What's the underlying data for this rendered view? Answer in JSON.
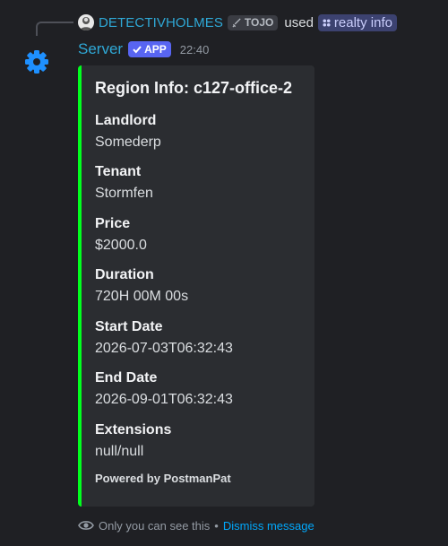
{
  "reply": {
    "username": "DETECTIVHOLMES",
    "tag": "TOJO",
    "used_text": "used",
    "command": "realty info"
  },
  "message": {
    "author": "Server",
    "badge": "APP",
    "timestamp": "22:40"
  },
  "embed": {
    "accent_color": "#00ff1e",
    "title": "Region Info: c127-office-2",
    "fields": [
      {
        "name": "Landlord",
        "value": "Somederp"
      },
      {
        "name": "Tenant",
        "value": "Stormfen"
      },
      {
        "name": "Price",
        "value": "$2000.0"
      },
      {
        "name": "Duration",
        "value": "720H 00M 00s"
      },
      {
        "name": "Start Date",
        "value": "2026-07-03T06:32:43"
      },
      {
        "name": "End Date",
        "value": "2026-09-01T06:32:43"
      },
      {
        "name": "Extensions",
        "value": "null/null"
      }
    ],
    "footer": "Powered by PostmanPat"
  },
  "ephemeral": {
    "text": "Only you can see this",
    "separator": "•",
    "dismiss": "Dismiss message"
  },
  "icons": {
    "avatar": "gear-icon",
    "visibility": "eye-icon",
    "command": "app-grid-icon",
    "badge": "check-icon"
  }
}
